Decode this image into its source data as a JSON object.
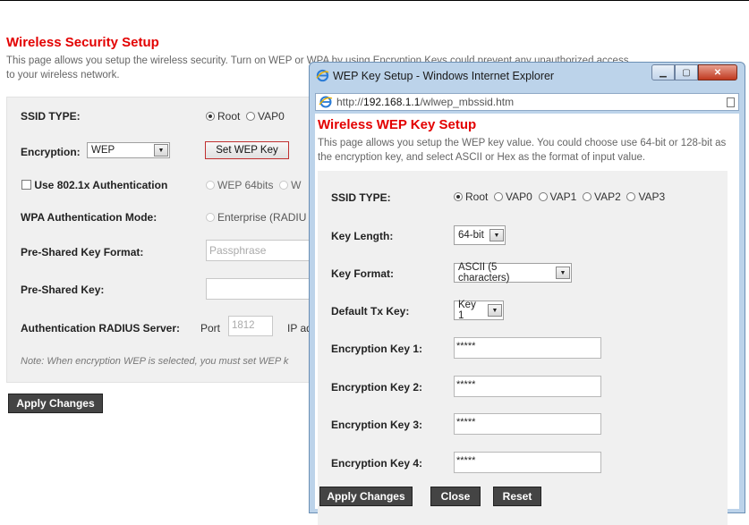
{
  "page": {
    "title": "Wireless Security Setup",
    "description": "This page allows you setup the wireless security. Turn on WEP or WPA by using Encryption Keys could prevent any unauthorized access to your wireless network.",
    "ssid_type_label": "SSID TYPE:",
    "ssid_options": [
      "Root",
      "VAP0"
    ],
    "encryption_label": "Encryption:",
    "encryption_value": "WEP",
    "set_wep_key_label": "Set WEP Key",
    "use_8021x_label": "Use 802.1x Authentication",
    "wep_options": [
      "WEP 64bits",
      "W"
    ],
    "wpa_auth_label": "WPA Authentication Mode:",
    "wpa_auth_value": "Enterprise (RADIU",
    "psk_format_label": "Pre-Shared Key Format:",
    "psk_format_value": "Passphrase",
    "psk_label": "Pre-Shared Key:",
    "radius_label": "Authentication RADIUS Server:",
    "port_label": "Port",
    "port_value": "1812",
    "ip_label": "IP ad",
    "note": "Note: When encryption WEP is selected, you must set WEP k",
    "apply_label": "Apply Changes"
  },
  "popup": {
    "window_title": "WEP Key Setup - Windows Internet Explorer",
    "url_prefix": "http://",
    "url_host": "192.168.1.1",
    "url_path": "/wlwep_mbssid.htm",
    "title": "Wireless WEP Key Setup",
    "description": "This page allows you setup the WEP key value. You could choose use 64-bit or 128-bit as the encryption key, and select ASCII or Hex as the format of input value.",
    "ssid_type_label": "SSID TYPE:",
    "ssid_options": [
      "Root",
      "VAP0",
      "VAP1",
      "VAP2",
      "VAP3"
    ],
    "key_length_label": "Key Length:",
    "key_length_value": "64-bit",
    "key_format_label": "Key Format:",
    "key_format_value": "ASCII (5 characters)",
    "default_tx_label": "Default Tx Key:",
    "default_tx_value": "Key 1",
    "keys": [
      {
        "label": "Encryption Key 1:",
        "value": "*****"
      },
      {
        "label": "Encryption Key 2:",
        "value": "*****"
      },
      {
        "label": "Encryption Key 3:",
        "value": "*****"
      },
      {
        "label": "Encryption Key 4:",
        "value": "*****"
      }
    ],
    "apply_label": "Apply Changes",
    "close_label": "Close",
    "reset_label": "Reset"
  },
  "colors": {
    "title_red": "#e30000",
    "button_dark": "#444444",
    "window_frame": "#bcd3ea"
  },
  "icons": [
    "ie-icon",
    "minimize-icon",
    "maximize-icon",
    "close-icon",
    "page-icon",
    "chevron-down-icon"
  ]
}
